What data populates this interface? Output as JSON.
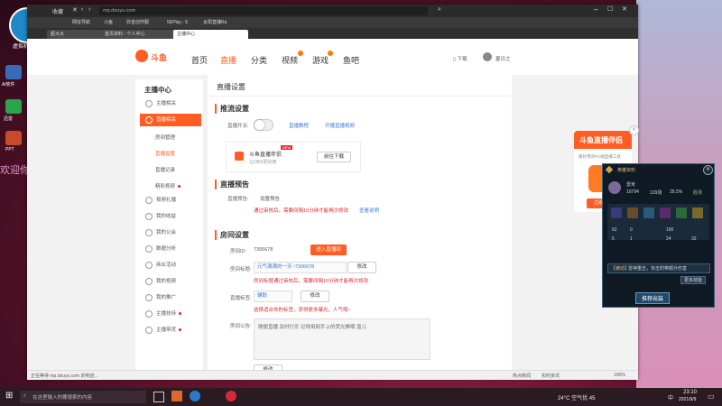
{
  "desktop": {
    "welcome_text": "欢迎你",
    "user_icon_label": "虚拟机",
    "icons": [
      "Ai软件",
      "迅雷",
      "PPT"
    ]
  },
  "browser": {
    "menu": "收藏",
    "bookmarks": [
      "网址导航",
      "斗鱼",
      "抖音创作服",
      "5EPlay - 5",
      "太阳直播Ra"
    ],
    "tabs": [
      "超大大",
      "首页资料 - 个人中心",
      "主播中心"
    ],
    "address": "mp.douyu.com"
  },
  "site_nav": {
    "logo_text": "斗鱼",
    "items": [
      "首页",
      "直播",
      "分类",
      "视频",
      "游戏",
      "鱼吧"
    ],
    "download": "下载",
    "user_name": "夏日之"
  },
  "sidebar": {
    "title": "主播中心",
    "items": [
      {
        "label": "主播相关"
      },
      {
        "label": "直播相关"
      },
      {
        "label": "房间管理",
        "sub": true
      },
      {
        "label": "直播设置",
        "sub": true
      },
      {
        "label": "直播记录",
        "sub": true
      },
      {
        "label": "精彩视频",
        "sub": true,
        "dot": true
      },
      {
        "label": "视频礼播"
      },
      {
        "label": "我的收益"
      },
      {
        "label": "我的公会"
      },
      {
        "label": "数据分析"
      },
      {
        "label": "商业活动"
      },
      {
        "label": "我的视频"
      },
      {
        "label": "我的推广"
      },
      {
        "label": "主播扶持",
        "dot": true
      },
      {
        "label": "主播带货",
        "dot": true
      }
    ]
  },
  "main": {
    "title": "直播设置",
    "push": {
      "section": "推流设置",
      "switch_label": "直播开关:",
      "tutorial_link": "直播教程",
      "record_link": "开播直播视频",
      "companion_title": "斗鱼直播伴侣",
      "companion_badge": "NEW",
      "companion_sub": "让OBS更好用",
      "download_btn": "前往下载"
    },
    "preview": {
      "section": "直播预告",
      "label": "直播预告:",
      "value": "设置预告",
      "warn": "通过审核后，需要间隔10分钟才能再次修改",
      "link": "查看说明"
    },
    "room": {
      "section": "房间设置",
      "id_label": "房间ID:",
      "id_value": "7306678",
      "enter_btn": "进入直播间",
      "title_label": "房间标题:",
      "title_value": "元气满满的一天~7306678",
      "title_btn": "修改",
      "title_warn": "房间标题通过审核后，需要间隔10分钟才能再次修改",
      "cat_label": "直播标签:",
      "cat_value": "辅助",
      "cat_btn": "修改",
      "cat_warn": "选择适合你的标签，获得更多曝光，人气哦~",
      "notice_label": "房间公告:",
      "notice_value": "随便直播 及时行乐 记得用网手上的荧光棒哦 蓝儿",
      "notice_btn": "修改"
    }
  },
  "promo": {
    "title": "斗鱼直播伴侣",
    "sub": "最好用的PC端直播工具",
    "btn": "立即下载"
  },
  "game_panel": {
    "title": "英雄资料",
    "player": "雷米",
    "stats": [
      "10794",
      "129场",
      "35.5%",
      "胜场"
    ],
    "rows": [
      "62",
      "0",
      "100",
      "5",
      "1",
      "24",
      "32"
    ],
    "rune_label": "【被动】",
    "rune_value": "雷神重击，攻击附带额外伤害",
    "more_btn": "更多技能",
    "rec_btn": "推荐出装"
  },
  "statusbar": {
    "left": "正在等待 mp.douyu.com 的响应...",
    "right": [
      "热点新闻",
      "实时资讯",
      "100%"
    ]
  },
  "taskbar": {
    "search_placeholder": "在这里输入你要搜索的内容",
    "weather": "24°C 空气优 45",
    "time": "23:10",
    "date": "2021/9/9",
    "lang": "中"
  }
}
